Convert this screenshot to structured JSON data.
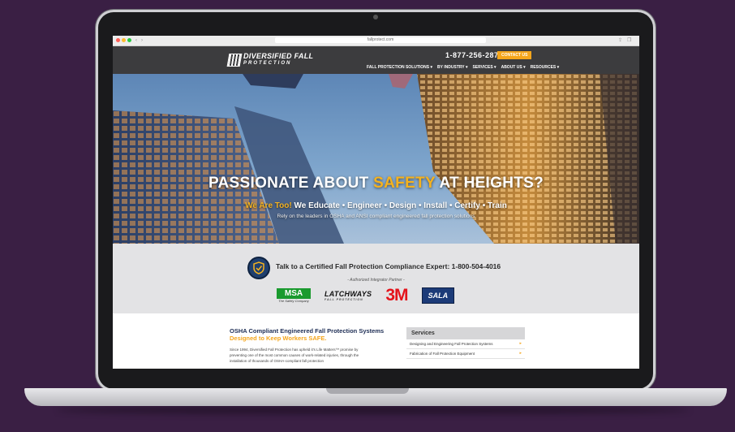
{
  "browser": {
    "url": "fallprotect.com"
  },
  "header": {
    "logo_line1": "DIVERSIFIED FALL",
    "logo_line2": "PROTECTION",
    "phone": "1-877-256-2870",
    "contact_button": "CONTACT US",
    "menu": [
      {
        "label": "FALL PROTECTION SOLUTIONS ▾"
      },
      {
        "label": "BY INDUSTRY ▾"
      },
      {
        "label": "SERVICES ▾"
      },
      {
        "label": "ABOUT US ▾"
      },
      {
        "label": "RESOURCES ▾"
      }
    ]
  },
  "hero": {
    "title_a": "PASSIONATE ABOUT ",
    "title_accent": "SAFETY",
    "title_b": " AT HEIGHTS?",
    "sub_accent": "We Are Too!",
    "sub_rest": " We Educate • Engineer • Design • Install • Certify • Train",
    "small": "Rely on the leaders in OSHA and ANSI compliant engineered fall protection solutions"
  },
  "compliance": {
    "text": "Talk to a Certified Fall Protection Compliance Expert: 1-800-504-4016",
    "partner_label": "- Authorized Integrator Partner -",
    "logos": {
      "msa": "MSA",
      "msa_tag": "The Safety Company",
      "latchways": "LATCHWAYS",
      "latchways_sub": "FALL PROTECTION",
      "threem": "3M",
      "sala": "SALA"
    }
  },
  "content": {
    "title": "OSHA Compliant Engineered Fall Protection Systems",
    "subtitle": "Designed to Keep Workers SAFE.",
    "body": "Since 1994, Diversified Fall Protection has upheld it's Life Matters™ promise by preventing one of the most common causes of work-related injuries, through the installation of thousands of OSHA-compliant fall protection"
  },
  "services": {
    "heading": "Services",
    "items": [
      {
        "label": "Designing and Engineering Fall Protection Systems"
      },
      {
        "label": "Fabrication of Fall Protection Equipment"
      }
    ]
  },
  "colors": {
    "accent": "#f5a61c",
    "header_bg": "#3c3c3e",
    "background": "#3a1f44",
    "navy": "#1e2e55"
  }
}
